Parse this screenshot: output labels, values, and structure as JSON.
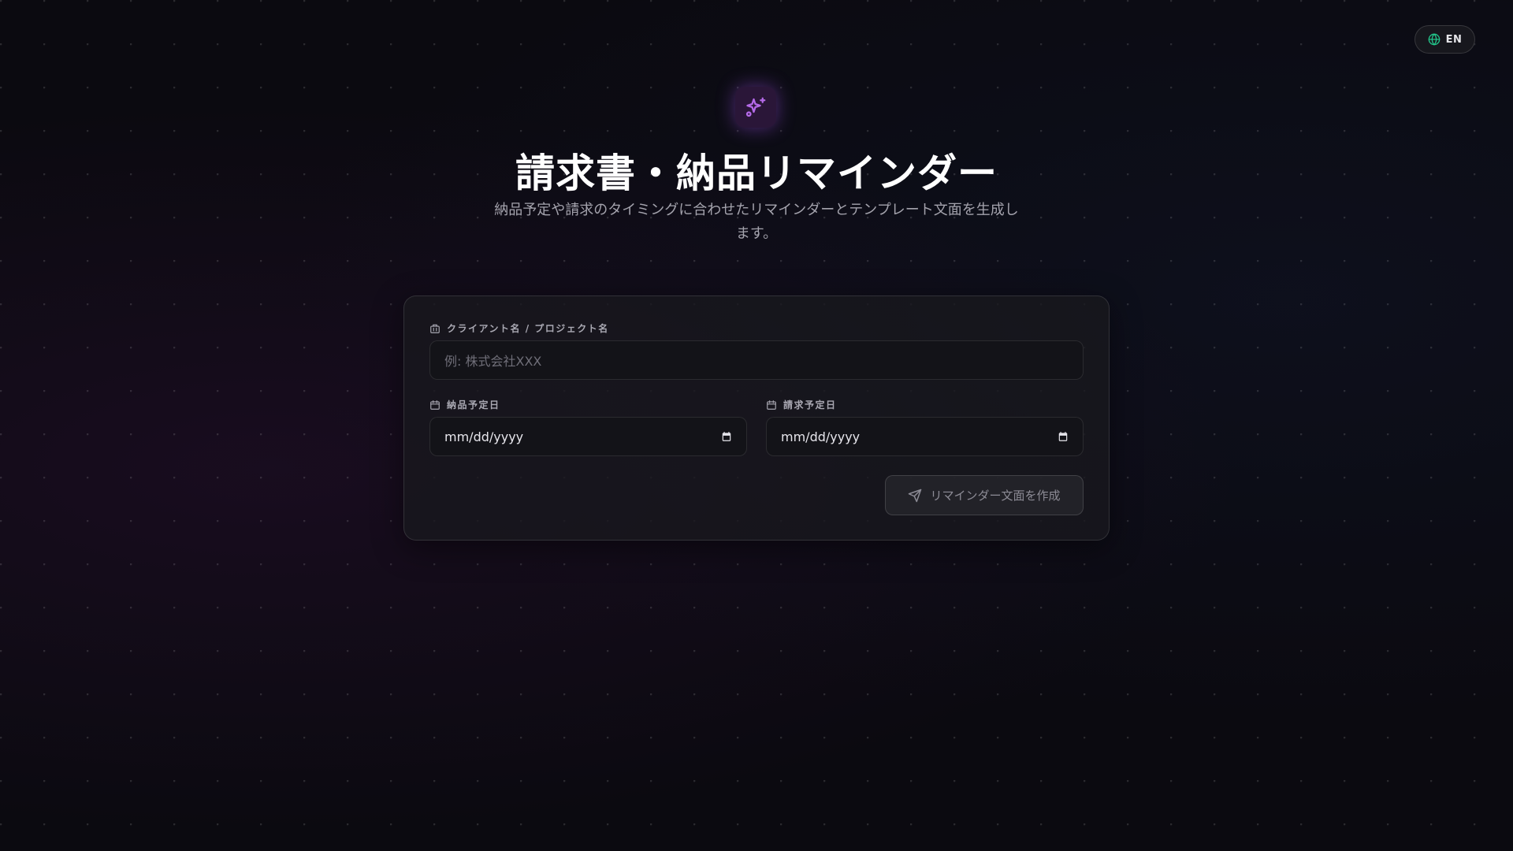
{
  "lang_toggle": {
    "label": "EN",
    "icon": "globe-icon",
    "icon_color": "#22c58a"
  },
  "hero": {
    "icon": "sparkles-icon",
    "accent": "#b46ae8",
    "title": "請求書・納品リマインダー",
    "subtitle": "納品予定や請求のタイミングに合わせたリマインダーとテンプレート文面を生成します。"
  },
  "form": {
    "client": {
      "label": "クライアント名 / プロジェクト名",
      "icon": "building-icon",
      "placeholder": "例: 株式会社XXX"
    },
    "delivery_date": {
      "label": "納品予定日",
      "icon": "calendar-icon",
      "value": "mm/dd/yyyy"
    },
    "invoice_date": {
      "label": "請求予定日",
      "icon": "calendar-icon",
      "value": "mm/dd/yyyy"
    },
    "submit": {
      "label": "リマインダー文面を作成",
      "icon": "send-icon"
    }
  }
}
